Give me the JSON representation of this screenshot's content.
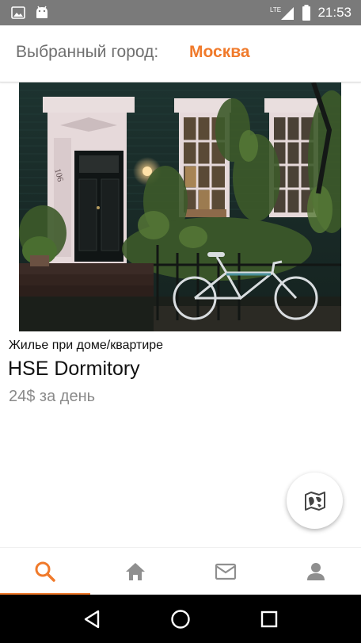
{
  "status_bar": {
    "time": "21:53",
    "network": "LTE",
    "icons": [
      "image-icon",
      "android-icon",
      "lte-signal-icon",
      "battery-icon"
    ]
  },
  "header": {
    "label": "Выбранный город:",
    "city": "Москва"
  },
  "listing": {
    "type": "Жилье при доме/квартире",
    "title": "HSE Dormitory",
    "price": "24$ за день",
    "photo_house_number": "106"
  },
  "fab": {
    "icon": "map-icon"
  },
  "bottom_nav": {
    "items": [
      {
        "icon": "search-icon",
        "active": true
      },
      {
        "icon": "home-icon",
        "active": false
      },
      {
        "icon": "mail-icon",
        "active": false
      },
      {
        "icon": "person-icon",
        "active": false
      }
    ]
  },
  "system_nav": {
    "icons": [
      "back-icon",
      "home-circle-icon",
      "recents-icon"
    ]
  },
  "colors": {
    "accent": "#f07a2b",
    "status_bar": "#7a7a7a",
    "nav_inactive": "#8f8f8f"
  }
}
